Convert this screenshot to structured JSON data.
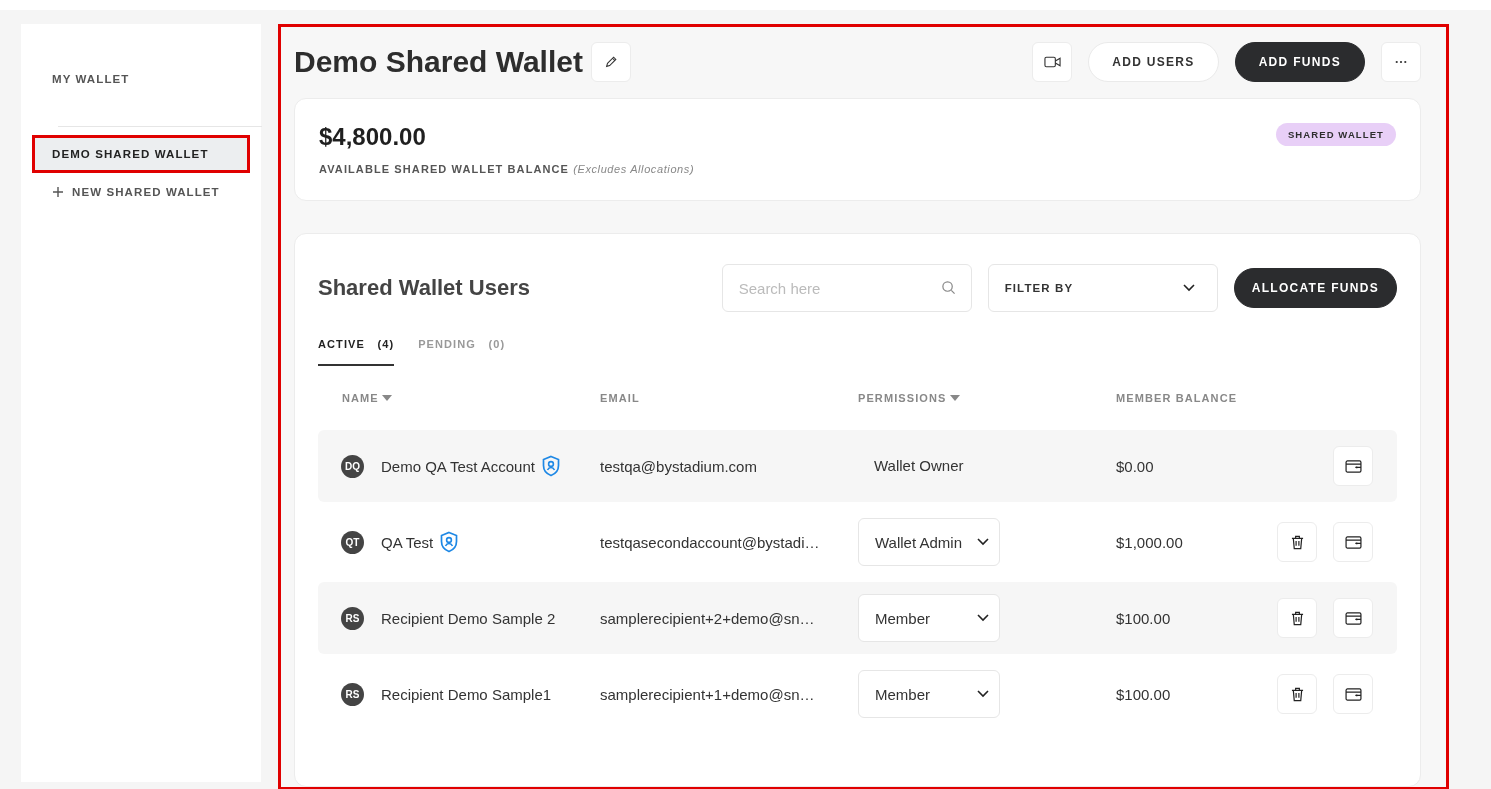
{
  "sidebar": {
    "items": [
      {
        "label": "MY WALLET",
        "kind": "link",
        "selected": false,
        "highlighted": false
      },
      {
        "label": "DEMO SHARED WALLET",
        "kind": "link",
        "selected": true,
        "highlighted": true
      },
      {
        "label": "NEW SHARED WALLET",
        "kind": "add",
        "selected": false,
        "highlighted": false
      }
    ]
  },
  "main": {
    "highlighted": true,
    "title": "Demo Shared Wallet",
    "buttons": {
      "add_users": "ADD USERS",
      "add_funds": "ADD FUNDS"
    },
    "balance": {
      "amount": "$4,800.00",
      "label": "AVAILABLE SHARED WALLET BALANCE",
      "note": "(Excludes Allocations)",
      "badge": "SHARED WALLET"
    },
    "users": {
      "title": "Shared Wallet Users",
      "search": {
        "placeholder": "Search here"
      },
      "filter": "FILTER BY",
      "allocate": "ALLOCATE FUNDS",
      "tabs": [
        {
          "label": "ACTIVE",
          "count": "(4)",
          "selected": true
        },
        {
          "label": "PENDING",
          "count": "(0)",
          "selected": false
        }
      ],
      "columns": [
        {
          "label": "NAME",
          "sortable": true
        },
        {
          "label": "EMAIL",
          "sortable": false
        },
        {
          "label": "PERMISSIONS",
          "sortable": true
        },
        {
          "label": "MEMBER BALANCE",
          "sortable": false
        }
      ],
      "rows": [
        {
          "initials": "DQ",
          "name": "Demo QA Test Account",
          "verified": true,
          "email": "testqa@bystadium.com",
          "permission": "Wallet Owner",
          "kind": "owner",
          "balance": "$0.00"
        },
        {
          "initials": "QT",
          "name": "QA Test",
          "verified": true,
          "email": "testqasecondaccount@bystadi…",
          "permission": "Wallet Admin",
          "kind": "editable",
          "balance": "$1,000.00"
        },
        {
          "initials": "RS",
          "name": "Recipient Demo Sample 2",
          "verified": false,
          "email": "samplerecipient+2+demo@sn…",
          "permission": "Member",
          "kind": "editable",
          "balance": "$100.00"
        },
        {
          "initials": "RS",
          "name": "Recipient Demo Sample1",
          "verified": false,
          "email": "samplerecipient+1+demo@sn…",
          "permission": "Member",
          "kind": "editable",
          "balance": "$100.00"
        }
      ]
    }
  }
}
